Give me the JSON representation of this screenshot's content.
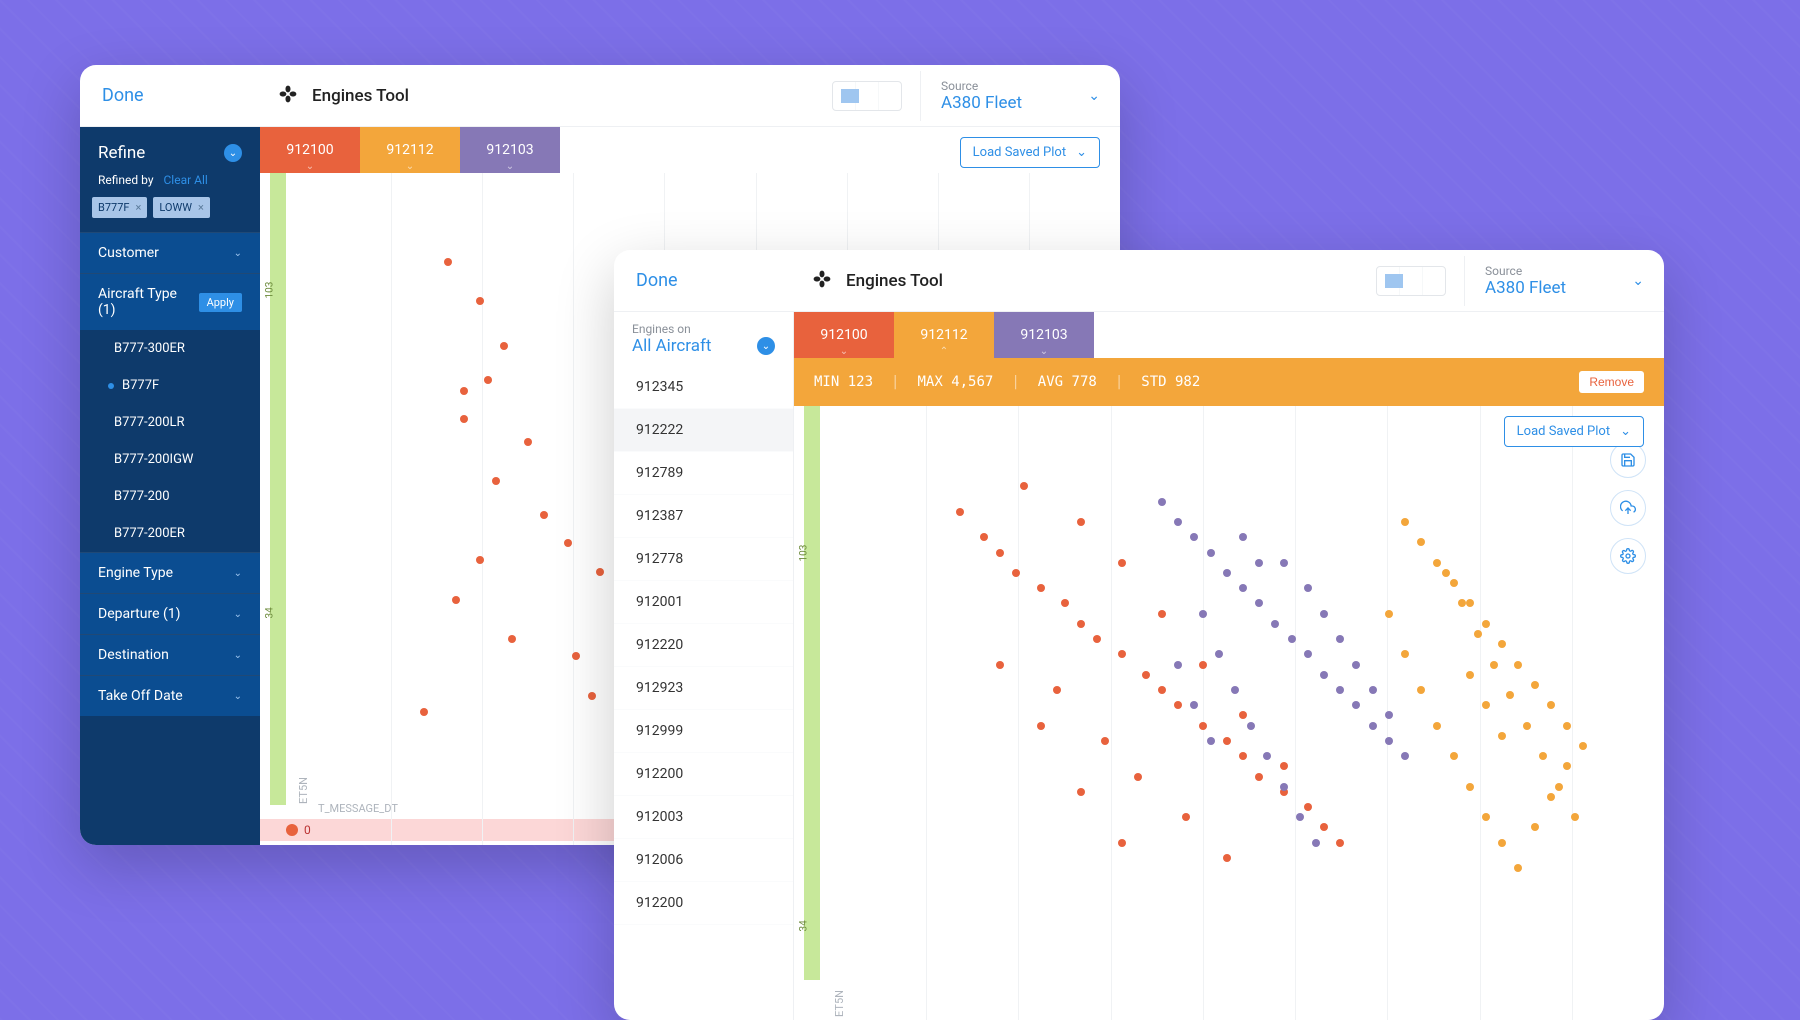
{
  "app": {
    "done": "Done",
    "title": "Engines Tool",
    "source_label": "Source",
    "source_value": "A380 Fleet",
    "load_saved": "Load Saved Plot"
  },
  "tabs": [
    {
      "id": "912100",
      "color": "orange"
    },
    {
      "id": "912112",
      "color": "amber"
    },
    {
      "id": "912103",
      "color": "violet"
    }
  ],
  "card_a": {
    "refine": "Refine",
    "refined_by": "Refined by",
    "clear_all": "Clear All",
    "chips": [
      "B777F",
      "LOWW"
    ],
    "filters": {
      "customer": "Customer",
      "aircraft_type": "Aircraft Type (1)",
      "apply": "Apply",
      "aircraft_items": [
        "B777-300ER",
        "B777F",
        "B777-200LR",
        "B777-200IGW",
        "B777-200",
        "B777-200ER"
      ],
      "selected_aircraft": "B777F",
      "engine_type": "Engine Type",
      "departure": "Departure (1)",
      "destination": "Destination",
      "takeoff": "Take Off Date"
    },
    "axes": {
      "y": "ET5N",
      "x": "T_MESSAGE_DT",
      "y_tick_a": "103",
      "y_tick_b": "34",
      "bottom_zero": "0"
    }
  },
  "card_b": {
    "engines_label": "Engines on",
    "engines_value": "All Aircraft",
    "engine_list": [
      "912345",
      "912222",
      "912789",
      "912387",
      "912778",
      "912001",
      "912220",
      "912923",
      "912999",
      "912200",
      "912003",
      "912006",
      "912200"
    ],
    "selected_engine": "912222",
    "stats": {
      "min_l": "MIN",
      "min": "123",
      "max_l": "MAX",
      "max": "4,567",
      "avg_l": "AVG",
      "avg": "778",
      "std_l": "STD",
      "std": "982"
    },
    "remove": "Remove",
    "axes": {
      "y_tick_a": "103",
      "y_tick_b": "34",
      "y": "ET5N"
    }
  },
  "colors": {
    "orange": "#e8623d",
    "amber": "#f3a63b",
    "violet": "#8678b6",
    "blue": "#2e8fe6",
    "navy": "#0e3a6b"
  },
  "chart_data": [
    {
      "type": "scatter",
      "title": "Card A scatter",
      "xlabel": "T_MESSAGE_DT",
      "ylabel": "ET5N",
      "ylim": [
        0,
        110
      ],
      "xlim": [
        0,
        100
      ],
      "y_ticks": [
        34,
        103
      ],
      "series": [
        {
          "name": "912100",
          "color": "#e8623d",
          "points": [
            [
              18,
              95
            ],
            [
              22,
              88
            ],
            [
              25,
              80
            ],
            [
              23,
              74
            ],
            [
              20,
              67
            ],
            [
              28,
              63
            ],
            [
              24,
              56
            ],
            [
              30,
              50
            ],
            [
              33,
              45
            ],
            [
              22,
              42
            ],
            [
              19,
              35
            ],
            [
              26,
              28
            ],
            [
              34,
              25
            ],
            [
              40,
              20
            ],
            [
              15,
              15
            ],
            [
              45,
              95
            ],
            [
              50,
              70
            ],
            [
              43,
              58
            ],
            [
              37,
              40
            ],
            [
              48,
              35
            ],
            [
              42,
              26
            ],
            [
              36,
              18
            ],
            [
              20,
              72
            ],
            [
              41,
              83
            ],
            [
              47,
              46
            ]
          ]
        },
        {
          "name": "912103",
          "color": "#8678b6",
          "points": [
            [
              55,
              96
            ],
            [
              52,
              88
            ],
            [
              50,
              80
            ],
            [
              48,
              73
            ],
            [
              46,
              65
            ],
            [
              44,
              58
            ],
            [
              42,
              52
            ],
            [
              45,
              47
            ],
            [
              48,
              41
            ],
            [
              51,
              36
            ],
            [
              54,
              30
            ],
            [
              57,
              25
            ],
            [
              52,
              20
            ],
            [
              49,
              78
            ],
            [
              53,
              70
            ],
            [
              56,
              62
            ],
            [
              51,
              55
            ],
            [
              47,
              48
            ],
            [
              43,
              33
            ],
            [
              58,
              40
            ],
            [
              56,
              50
            ],
            [
              60,
              45
            ],
            [
              50,
              90
            ],
            [
              54,
              85
            ]
          ]
        }
      ]
    },
    {
      "type": "scatter",
      "title": "Card B scatter (three series)",
      "ylabel": "ET5N",
      "ylim": [
        0,
        110
      ],
      "xlim": [
        0,
        100
      ],
      "y_ticks": [
        34,
        103
      ],
      "stats": {
        "min": 123,
        "max": 4567,
        "avg": 778,
        "std": 982
      },
      "series": [
        {
          "name": "912100",
          "color": "#e8623d",
          "points": [
            [
              15,
              90
            ],
            [
              18,
              85
            ],
            [
              20,
              82
            ],
            [
              22,
              78
            ],
            [
              25,
              75
            ],
            [
              28,
              72
            ],
            [
              30,
              68
            ],
            [
              32,
              65
            ],
            [
              35,
              62
            ],
            [
              38,
              58
            ],
            [
              40,
              55
            ],
            [
              42,
              52
            ],
            [
              45,
              48
            ],
            [
              48,
              45
            ],
            [
              50,
              42
            ],
            [
              52,
              38
            ],
            [
              55,
              35
            ],
            [
              58,
              32
            ],
            [
              60,
              28
            ],
            [
              62,
              25
            ],
            [
              30,
              88
            ],
            [
              35,
              80
            ],
            [
              40,
              70
            ],
            [
              45,
              60
            ],
            [
              50,
              50
            ],
            [
              55,
              40
            ],
            [
              33,
              45
            ],
            [
              27,
              55
            ],
            [
              43,
              30
            ],
            [
              37,
              38
            ],
            [
              48,
              22
            ],
            [
              20,
              60
            ],
            [
              25,
              48
            ],
            [
              30,
              35
            ],
            [
              35,
              25
            ],
            [
              23,
              95
            ]
          ]
        },
        {
          "name": "912103",
          "color": "#8678b6",
          "points": [
            [
              40,
              92
            ],
            [
              42,
              88
            ],
            [
              44,
              85
            ],
            [
              46,
              82
            ],
            [
              48,
              78
            ],
            [
              50,
              75
            ],
            [
              52,
              72
            ],
            [
              54,
              68
            ],
            [
              56,
              65
            ],
            [
              58,
              62
            ],
            [
              60,
              58
            ],
            [
              62,
              55
            ],
            [
              64,
              52
            ],
            [
              66,
              48
            ],
            [
              68,
              45
            ],
            [
              70,
              42
            ],
            [
              55,
              80
            ],
            [
              58,
              75
            ],
            [
              60,
              70
            ],
            [
              62,
              65
            ],
            [
              64,
              60
            ],
            [
              66,
              55
            ],
            [
              68,
              50
            ],
            [
              50,
              85
            ],
            [
              52,
              80
            ],
            [
              45,
              70
            ],
            [
              47,
              62
            ],
            [
              49,
              55
            ],
            [
              51,
              48
            ],
            [
              53,
              42
            ],
            [
              55,
              36
            ],
            [
              57,
              30
            ],
            [
              59,
              25
            ],
            [
              42,
              60
            ],
            [
              44,
              52
            ],
            [
              46,
              45
            ]
          ]
        },
        {
          "name": "912112",
          "color": "#f3a63b",
          "points": [
            [
              70,
              88
            ],
            [
              72,
              84
            ],
            [
              74,
              80
            ],
            [
              76,
              76
            ],
            [
              78,
              72
            ],
            [
              80,
              68
            ],
            [
              82,
              64
            ],
            [
              84,
              60
            ],
            [
              86,
              56
            ],
            [
              88,
              52
            ],
            [
              90,
              48
            ],
            [
              92,
              44
            ],
            [
              75,
              78
            ],
            [
              77,
              72
            ],
            [
              79,
              66
            ],
            [
              81,
              60
            ],
            [
              83,
              54
            ],
            [
              85,
              48
            ],
            [
              87,
              42
            ],
            [
              89,
              36
            ],
            [
              91,
              30
            ],
            [
              68,
              70
            ],
            [
              70,
              62
            ],
            [
              72,
              55
            ],
            [
              74,
              48
            ],
            [
              76,
              42
            ],
            [
              78,
              36
            ],
            [
              80,
              30
            ],
            [
              82,
              25
            ],
            [
              84,
              20
            ],
            [
              86,
              28
            ],
            [
              88,
              34
            ],
            [
              90,
              40
            ],
            [
              78,
              58
            ],
            [
              80,
              52
            ],
            [
              82,
              46
            ]
          ]
        }
      ]
    }
  ]
}
